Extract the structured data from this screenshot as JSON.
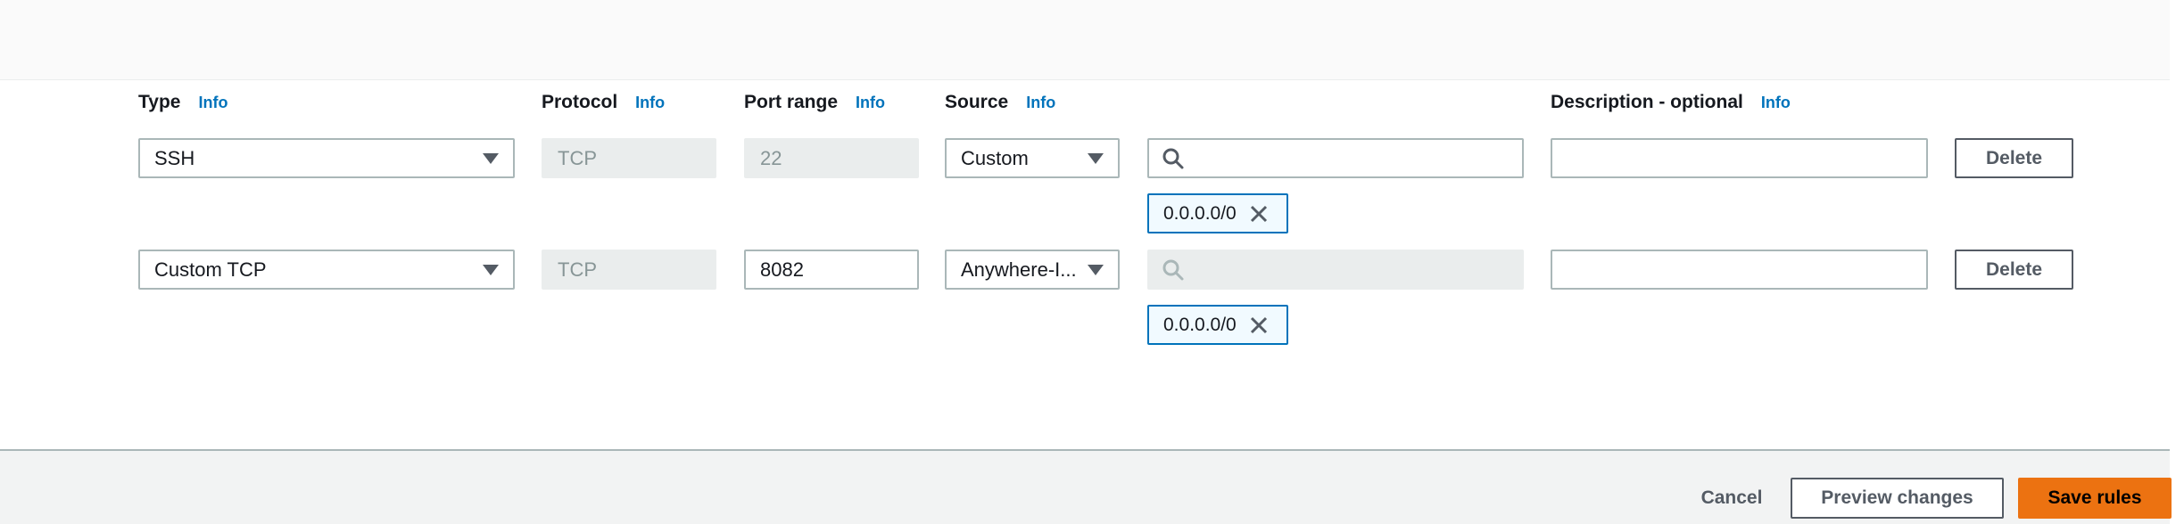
{
  "columns": {
    "type": {
      "label": "Type",
      "info": "Info"
    },
    "protocol": {
      "label": "Protocol",
      "info": "Info"
    },
    "port_range": {
      "label": "Port range",
      "info": "Info"
    },
    "source": {
      "label": "Source",
      "info": "Info"
    },
    "description": {
      "label": "Description - optional",
      "info": "Info"
    }
  },
  "rules": [
    {
      "type": "SSH",
      "protocol": "TCP",
      "port_range": "22",
      "source": "Custom",
      "cidr_search_value": "",
      "cidr_token": "0.0.0.0/0",
      "description": "",
      "delete_label": "Delete"
    },
    {
      "type": "Custom TCP",
      "protocol": "TCP",
      "port_range": "8082",
      "source": "Anywhere-I...",
      "cidr_search_value": "",
      "cidr_token": "0.0.0.0/0",
      "description": "",
      "delete_label": "Delete"
    }
  ],
  "footer": {
    "cancel_label": "Cancel",
    "preview_label": "Preview changes",
    "save_label": "Save rules"
  },
  "colors": {
    "accent": "#ec7211",
    "link": "#0073bb",
    "token_border": "#0073bb"
  },
  "icons": [
    "search-icon",
    "close-icon",
    "caret-down-icon"
  ]
}
